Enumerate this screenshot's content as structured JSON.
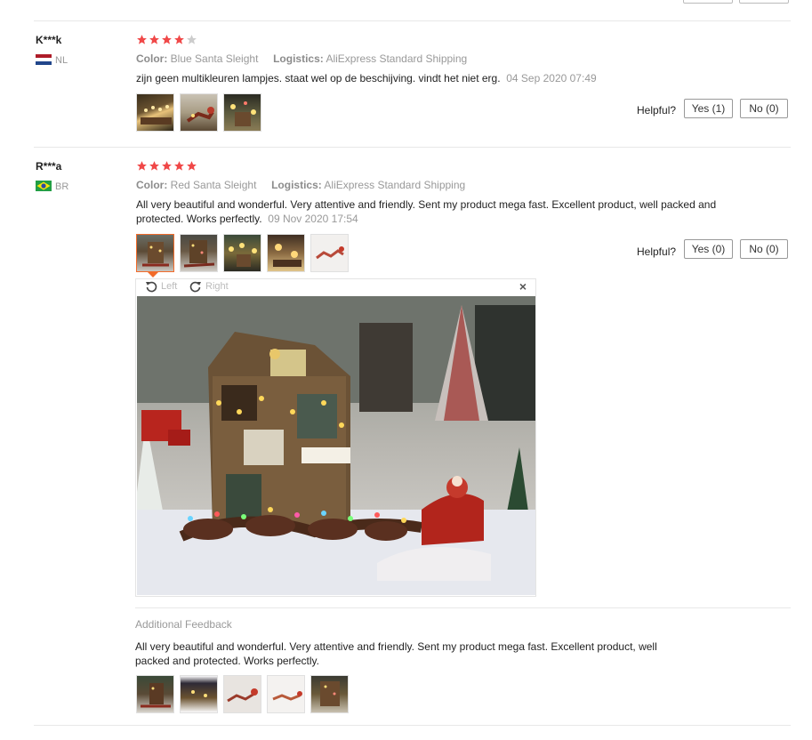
{
  "reviews": [
    {
      "name": "K***k",
      "country": "NL",
      "stars_filled": 4,
      "color_label": "Color:",
      "color_value": "Blue Santa Sleight",
      "logistics_label": "Logistics:",
      "logistics_value": "AliExpress Standard Shipping",
      "text": "zijn geen multikleuren lampjes. staat wel op de beschijving. vindt het niet erg.",
      "date": "04 Sep 2020 07:49",
      "helpful_label": "Helpful?",
      "yes_label": "Yes (1)",
      "no_label": "No (0)"
    },
    {
      "name": "R***a",
      "country": "BR",
      "stars_filled": 5,
      "color_label": "Color:",
      "color_value": "Red Santa Sleight",
      "logistics_label": "Logistics:",
      "logistics_value": "AliExpress Standard Shipping",
      "text": "All very beautiful and wonderful. Very attentive and friendly. Sent my product mega fast. Excellent product, well packed and protected. Works perfectly.",
      "date": "09 Nov 2020 17:54",
      "helpful_label": "Helpful?",
      "yes_label": "Yes (0)",
      "no_label": "No (0)",
      "viewer": {
        "left_label": "Left",
        "right_label": "Right",
        "close_label": "×"
      },
      "additional_title": "Additional Feedback",
      "additional_text": "All very beautiful and wonderful. Very attentive and friendly. Sent my product mega fast. Excellent product, well packed and protected. Works perfectly."
    }
  ],
  "colors": {
    "star": "#f04848",
    "star_empty": "#cccccc",
    "accent": "#f26b2a"
  }
}
